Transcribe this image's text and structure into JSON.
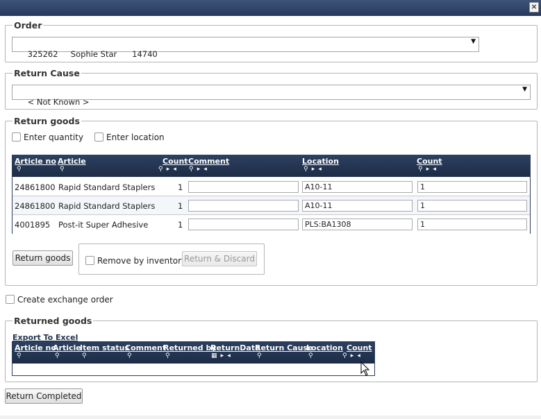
{
  "window": {
    "close_glyph": "×"
  },
  "order": {
    "legend": "Order",
    "selected": "325262     Sophie Star      14740"
  },
  "return_cause": {
    "legend": "Return Cause",
    "selected": "< Not Known >"
  },
  "return_goods": {
    "legend": "Return goods",
    "enter_quantity": "Enter quantity",
    "enter_location": "Enter location",
    "columns": [
      "Article no",
      "Article",
      "Count",
      "Comment",
      "Location",
      "Count"
    ],
    "rows": [
      {
        "article_no": "24861800",
        "article": "Rapid Standard Staplers",
        "count": "1",
        "comment": "",
        "location": "A10-11",
        "count_input": "1"
      },
      {
        "article_no": "24861800",
        "article": "Rapid Standard Staplers",
        "count": "1",
        "comment": "",
        "location": "A10-11",
        "count_input": "1"
      },
      {
        "article_no": "4001895",
        "article": "Post-it Super Adhesive",
        "count": "1",
        "comment": "",
        "location": "PLS:BA1308",
        "count_input": "1"
      }
    ],
    "return_button": "Return goods",
    "remove_by_inventory": "Remove by inventory",
    "return_discard_button": "Return & Discard"
  },
  "exchange": {
    "label": "Create exchange order"
  },
  "returned_goods": {
    "legend": "Returned goods",
    "export_link": "Export To Excel",
    "columns": [
      "Article no",
      "Article",
      "Item status",
      "Comment",
      "Returned by",
      "ReturnDate",
      "Return Cause",
      "Location",
      "Count"
    ]
  },
  "footer": {
    "return_completed": "Return Completed"
  }
}
